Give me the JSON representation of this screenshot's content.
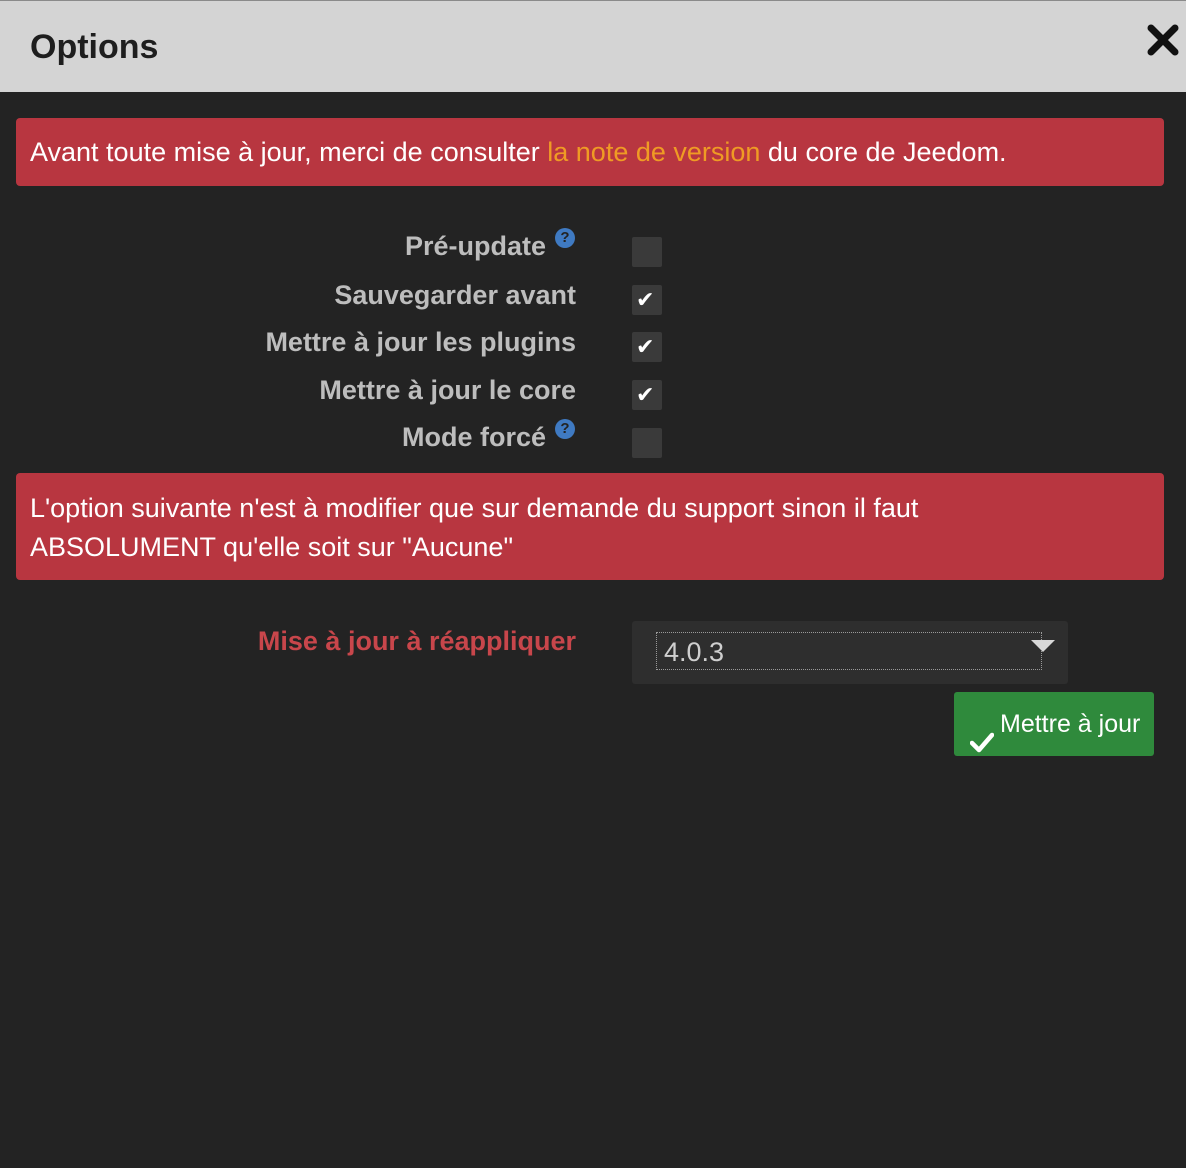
{
  "modal": {
    "title": "Options",
    "close_icon": "close-icon"
  },
  "alert_top": {
    "before": "Avant toute mise à jour, merci de consulter ",
    "link": "la note de version",
    "after": " du core de Jeedom."
  },
  "options": [
    {
      "label": "Pré-update",
      "help": "?",
      "checked": false
    },
    {
      "label": "Sauvegarder avant",
      "checked": true
    },
    {
      "label": "Mettre à jour les plugins",
      "checked": true
    },
    {
      "label": "Mettre à jour le core",
      "checked": true
    },
    {
      "label": "Mode forcé",
      "help": "?",
      "checked": false
    }
  ],
  "checkmark": "✔",
  "alert_support": {
    "line1": "L'option suivante n'est à modifier que sur demande du support sinon il faut",
    "line2": "ABSOLUMENT qu'elle soit sur \"Aucune\""
  },
  "reapply": {
    "label": "Mise à jour à réappliquer",
    "selected": "4.0.3"
  },
  "update_button": {
    "label": "Mettre à jour",
    "icon": "check-icon"
  },
  "colors": {
    "header_bg": "#d4d4d4",
    "body_bg": "#232323",
    "alert_red": "#b83640",
    "link_orange": "#ef9b24",
    "success_green": "#2f8a3c",
    "help_blue": "#3f7ac2"
  }
}
